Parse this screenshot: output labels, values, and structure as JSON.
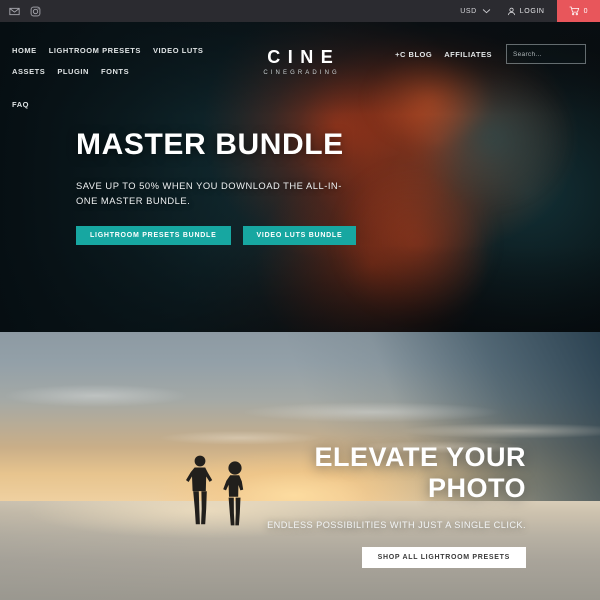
{
  "topbar": {
    "icons": [
      {
        "name": "email-icon",
        "glyph": "envelope"
      },
      {
        "name": "instagram-icon",
        "glyph": "instagram"
      }
    ],
    "currency": "USD",
    "login_label": "LOGIN",
    "cart_count": "0"
  },
  "header": {
    "nav": [
      {
        "label": "HOME"
      },
      {
        "label": "LIGHTROOM PRESETS"
      },
      {
        "label": "VIDEO LUTS"
      },
      {
        "label": "ASSETS"
      },
      {
        "label": "PLUGIN"
      },
      {
        "label": "FONTS"
      },
      {
        "label": "FAQ"
      }
    ],
    "logo_main": "CINE",
    "logo_sub": "CINEGRADING",
    "right_links": [
      {
        "label": "+C BLOG"
      },
      {
        "label": "AFFILIATES"
      }
    ],
    "search": {
      "placeholder": "Search...",
      "value": ""
    }
  },
  "hero": {
    "title": "MASTER BUNDLE",
    "subtitle": "SAVE UP TO 50% WHEN YOU DOWNLOAD THE ALL-IN-ONE MASTER BUNDLE.",
    "buttons": [
      {
        "label": "LIGHTROOM PRESETS BUNDLE"
      },
      {
        "label": "VIDEO LUTS BUNDLE"
      }
    ],
    "image_alt": "cinematic portrait with red and teal lighting"
  },
  "section2": {
    "title_line1": "ELEVATE YOUR",
    "title_line2": "PHOTO",
    "subtitle": "ENDLESS POSSIBILITIES WITH JUST A SINGLE CLICK.",
    "button_label": "SHOP ALL LIGHTROOM PRESETS",
    "image_alt": "two silhouetted people on a beach at sunset"
  },
  "colors": {
    "accent_teal": "#17a7a1",
    "cart_red": "#e8565b",
    "topbar_bg": "#2b2b30",
    "text_light": "#ffffff"
  }
}
